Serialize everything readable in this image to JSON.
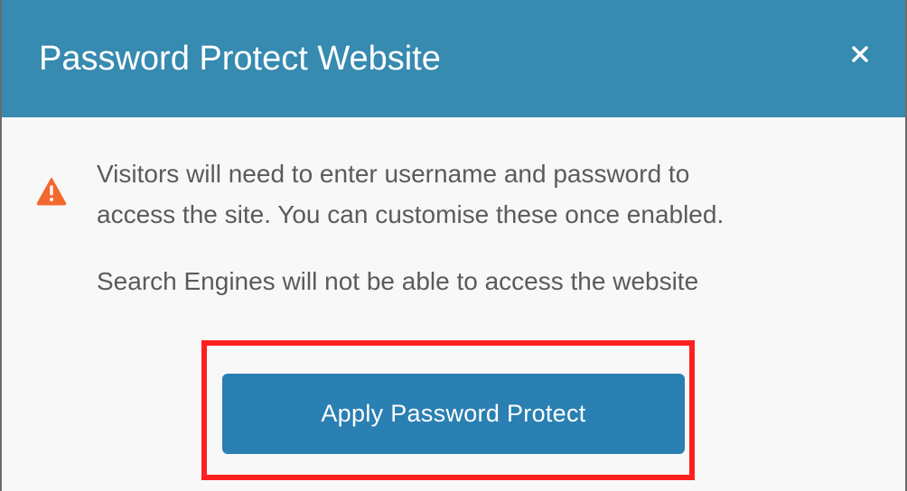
{
  "dialog": {
    "title": "Password Protect Website",
    "close_icon": "close-icon",
    "warning_icon": "warning-triangle-icon",
    "message_line_1": "Visitors will need to enter username and password to",
    "message_line_2": "access the site. You can customise these once enabled.",
    "message_line_3": "Search Engines will not be able to access the website",
    "apply_label": "Apply Password Protect"
  },
  "colors": {
    "header": "#378ab0",
    "button": "#2a7fb3",
    "warning": "#f2692f",
    "highlight": "#ff2020",
    "body_text": "#5b5b5b"
  }
}
